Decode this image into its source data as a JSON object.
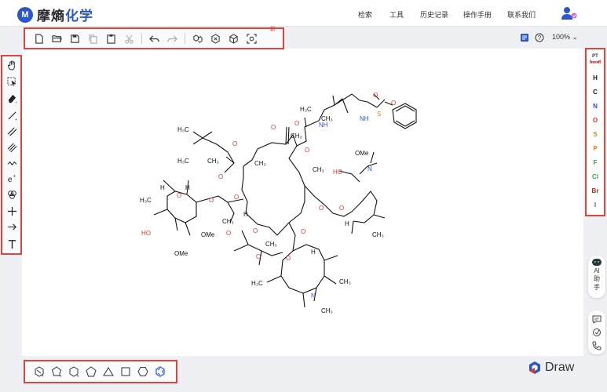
{
  "app": {
    "logo_mark": "M",
    "name_part1": "摩熵",
    "name_part2": "化学",
    "brand": "Draw"
  },
  "nav": {
    "items": [
      "检索",
      "工具",
      "历史记录",
      "操作手册",
      "联系我们"
    ]
  },
  "toolbar": {
    "new_badge": "新",
    "buttons": [
      {
        "name": "new-file",
        "icon": "file-icon"
      },
      {
        "name": "open-file",
        "icon": "folder-open-icon"
      },
      {
        "name": "save-file",
        "icon": "save-icon"
      },
      {
        "name": "copy",
        "icon": "copy-icon"
      },
      {
        "name": "paste",
        "icon": "clipboard-icon"
      },
      {
        "name": "cut",
        "icon": "scissors-icon"
      },
      {
        "name": "undo",
        "icon": "undo-icon"
      },
      {
        "name": "redo",
        "icon": "redo-icon"
      },
      {
        "name": "layout",
        "icon": "layout-icon"
      },
      {
        "name": "clean",
        "icon": "clean-icon"
      },
      {
        "name": "3d-view",
        "icon": "cube-icon"
      },
      {
        "name": "recognize",
        "icon": "scan-icon"
      }
    ]
  },
  "view": {
    "zoom": "100%"
  },
  "left_tools": [
    {
      "name": "hand-tool",
      "icon": "hand-icon"
    },
    {
      "name": "select-tool",
      "icon": "select-icon"
    },
    {
      "name": "eraser-tool",
      "icon": "eraser-icon"
    },
    {
      "name": "single-bond-tool",
      "icon": "single-bond-icon"
    },
    {
      "name": "double-bond-tool",
      "icon": "double-bond-icon"
    },
    {
      "name": "triple-bond-tool",
      "icon": "triple-bond-icon"
    },
    {
      "name": "chain-tool",
      "icon": "chain-icon"
    },
    {
      "name": "charge-tool",
      "icon": "charge-icon"
    },
    {
      "name": "template-tool",
      "icon": "template-icon"
    },
    {
      "name": "plus-tool",
      "icon": "plus-icon"
    },
    {
      "name": "arrow-tool",
      "icon": "arrow-icon"
    },
    {
      "name": "text-tool",
      "icon": "text-icon"
    }
  ],
  "elements": {
    "periodic_table": "PT",
    "items": [
      {
        "symbol": "H",
        "color": "#111111"
      },
      {
        "symbol": "C",
        "color": "#111111"
      },
      {
        "symbol": "N",
        "color": "#2b52c7"
      },
      {
        "symbol": "O",
        "color": "#d93a2f"
      },
      {
        "symbol": "S",
        "color": "#c9901a"
      },
      {
        "symbol": "P",
        "color": "#e67a1f"
      },
      {
        "symbol": "F",
        "color": "#3aa63a"
      },
      {
        "symbol": "Cl",
        "color": "#3aa63a"
      },
      {
        "symbol": "Br",
        "color": "#a33224"
      },
      {
        "symbol": "I",
        "color": "#8a2be2"
      }
    ]
  },
  "ai_assistant": {
    "label1": "AI",
    "label2": "助",
    "label3": "手"
  },
  "shapes": [
    {
      "name": "cyclopropane",
      "icon": "cyclopropane-icon"
    },
    {
      "name": "cyclobutane",
      "icon": "cyclobutane-icon"
    },
    {
      "name": "cyclopentane",
      "icon": "cyclopentane-icon"
    },
    {
      "name": "pentagon",
      "icon": "pentagon-icon"
    },
    {
      "name": "triangle",
      "icon": "triangle-icon"
    },
    {
      "name": "square",
      "icon": "square-icon"
    },
    {
      "name": "hexagon",
      "icon": "hexagon-icon"
    },
    {
      "name": "benzene",
      "icon": "benzene-icon"
    }
  ],
  "molecule_labels": {
    "ch3": "CH₃",
    "h3c": "H₃C",
    "o": "O",
    "h": "H",
    "ho": "HO",
    "ome": "OMe",
    "nh": "NH",
    "n": "N",
    "s": "S",
    "ome_n": "OMe"
  },
  "colors": {
    "highlight": "#e0443e",
    "brand_blue": "#2b57c9",
    "oxygen": "#d93a2f",
    "nitrogen": "#2b52c7",
    "sulfur": "#c9901a"
  }
}
